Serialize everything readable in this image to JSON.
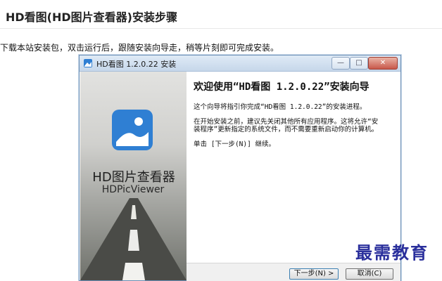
{
  "page": {
    "title": "HD看图(HD图片查看器)安装步骤",
    "intro": "下载本站安装包，双击运行后，跟随安装向导走，稍等片刻即可完成安装。"
  },
  "installer": {
    "window_title": "HD看图 1.2.0.22 安装",
    "titlebar_buttons": {
      "minimize": "—",
      "maximize": "□",
      "close": "✕"
    },
    "side": {
      "app_name": "HD图片查看器",
      "app_sub": "HDPicViewer"
    },
    "welcome_heading": "欢迎使用“HD看图 1.2.0.22”安装向导",
    "paragraphs": [
      "这个向导将指引你完成“HD看图 1.2.0.22”的安装进程。",
      "在开始安装之前，建议先关闭其他所有应用程序。这将允许“安装程序”更新指定的系统文件，而不需要重新启动你的计算机。",
      "单击 [下一步(N)] 继续。"
    ],
    "buttons": {
      "next": "下一步(N) >",
      "cancel": "取消(C)"
    }
  },
  "watermark": "最需教育",
  "colors": {
    "watermark": "#2a2f9c",
    "titlebar": "#c6d7ea",
    "icon_blue": "#2f7fd3"
  }
}
